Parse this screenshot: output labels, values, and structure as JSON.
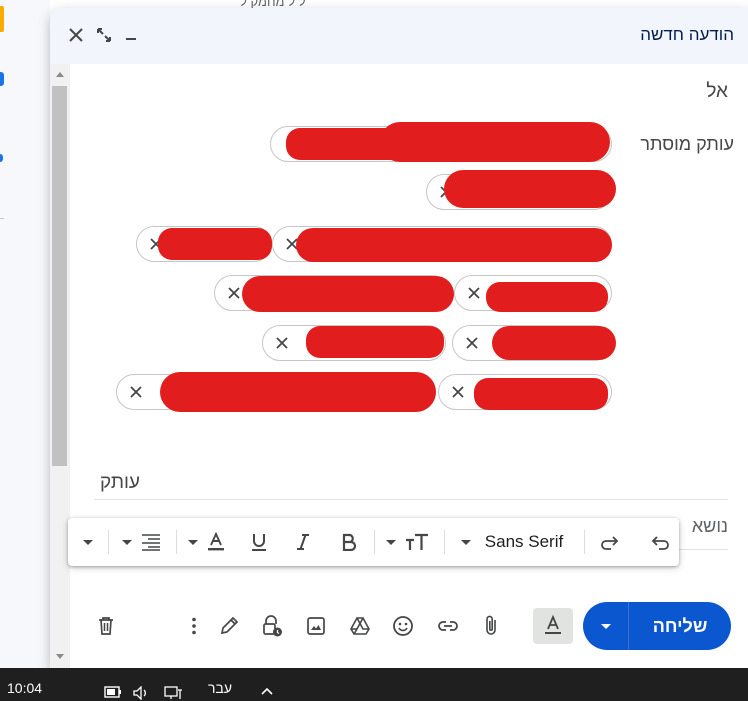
{
  "background": {
    "top_fragment": "ל ל מחמק ל"
  },
  "dialog": {
    "title": "הודעה חדשה",
    "controls": [
      "close-icon",
      "fullscreen-icon",
      "minimize-icon"
    ]
  },
  "recipients": {
    "to_label": "אל",
    "bcc_hidden_label": "עותק מוסתר",
    "chips": [
      {
        "name": "chip-1",
        "text": ""
      },
      {
        "name": "chip-2",
        "text": ""
      },
      {
        "name": "chip-3",
        "text": ""
      },
      {
        "name": "chip-4",
        "text": ""
      },
      {
        "name": "chip-5",
        "text": ""
      },
      {
        "name": "chip-6",
        "text": ""
      },
      {
        "name": "chip-7",
        "text": ""
      },
      {
        "name": "chip-8",
        "text": ""
      },
      {
        "name": "chip-9",
        "text": ""
      },
      {
        "name": "chip-10",
        "text": ""
      },
      {
        "name": "chip-11",
        "text": ""
      }
    ],
    "cc_label": "עותק"
  },
  "subject": {
    "label": "נושא"
  },
  "format_toolbar": {
    "font_name": "Sans Serif",
    "buttons": [
      "undo-icon",
      "redo-icon",
      "font-dropdown",
      "text-size-icon",
      "bold-icon",
      "italic-icon",
      "underline-icon",
      "text-color-icon",
      "align-icon",
      "more-formatting"
    ]
  },
  "bottom_toolbar": {
    "send_label": "שליחה",
    "icons": [
      "attach-icon",
      "link-icon",
      "emoji-icon",
      "drive-icon",
      "image-icon",
      "confidential-icon",
      "signature-icon",
      "more-options-icon",
      "delete-icon"
    ]
  },
  "taskbar": {
    "time": "10:04",
    "language": "עבר"
  },
  "colors": {
    "accent_blue": "#0b57d0",
    "header_bg": "#f2f6fc",
    "redaction": "#e21d1d"
  }
}
